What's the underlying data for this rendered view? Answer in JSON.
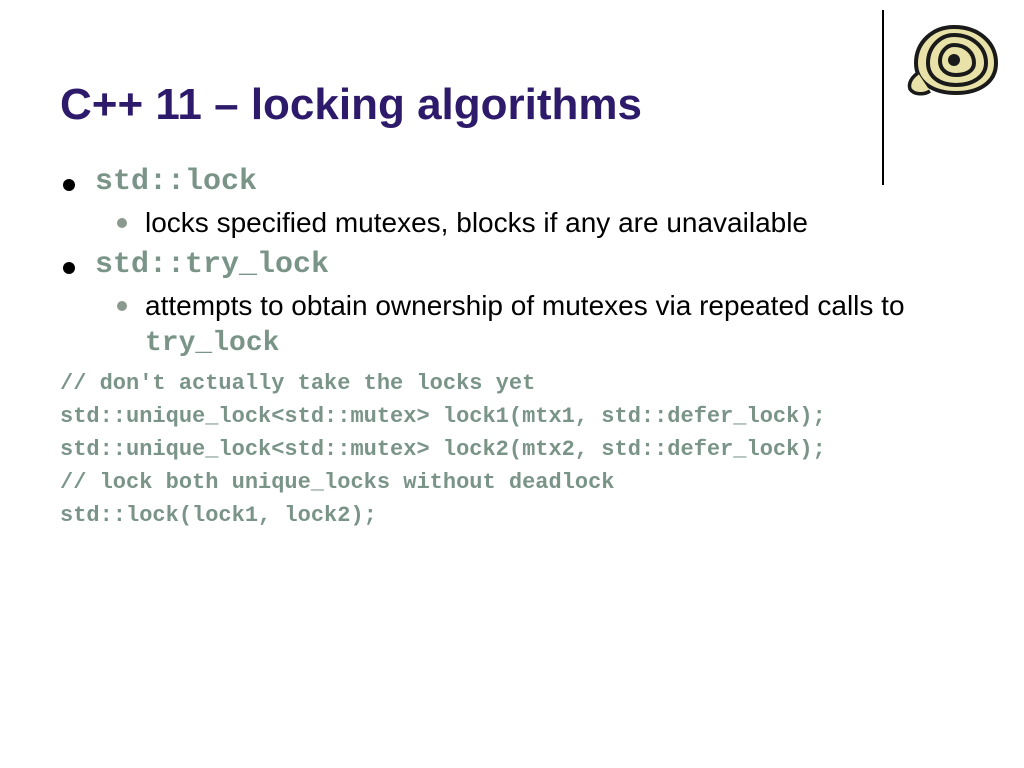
{
  "title": "C++ 11 – locking algorithms",
  "bullets": {
    "b1": {
      "head": "std::lock",
      "desc": "locks specified mutexes, blocks if any are unavailable"
    },
    "b2": {
      "head": "std::try_lock",
      "desc_pre": "attempts to obtain ownership of mutexes via repeated calls to ",
      "desc_code": "try_lock"
    }
  },
  "code": {
    "l1": "// don't actually take the locks yet",
    "l2": "std::unique_lock<std::mutex> lock1(mtx1, std::defer_lock);",
    "l3": "std::unique_lock<std::mutex> lock2(mtx2, std::defer_lock);",
    "l4": "// lock both unique_locks without deadlock",
    "l5": "std::lock(lock1, lock2);"
  }
}
